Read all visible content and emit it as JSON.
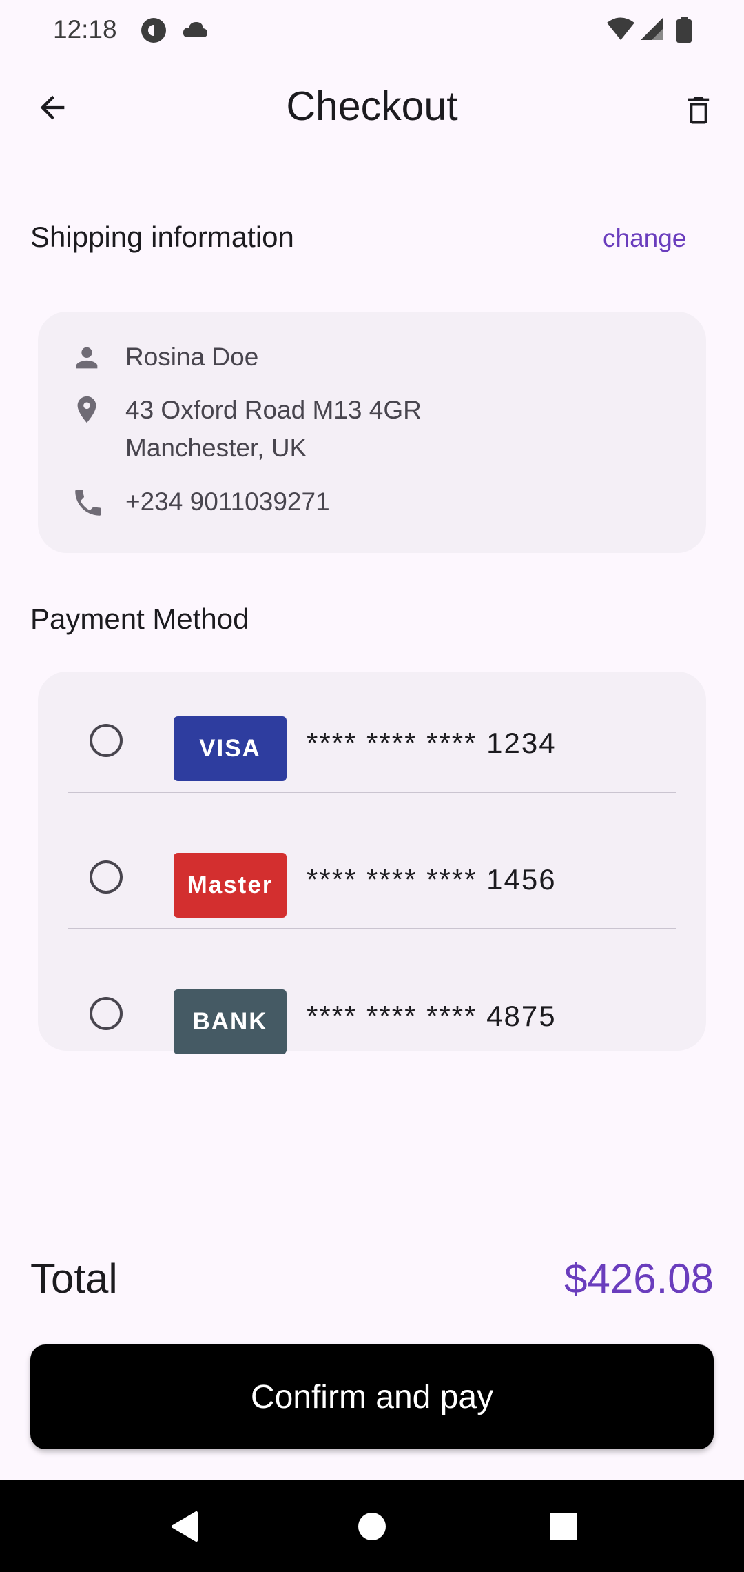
{
  "status_bar": {
    "time": "12:18",
    "icons": [
      "pocket-casts-icon",
      "cloud-icon",
      "wifi-icon",
      "signal-icon",
      "battery-icon"
    ]
  },
  "app_bar": {
    "title": "Checkout",
    "back_icon": "arrow-back-icon",
    "delete_icon": "trash-icon"
  },
  "shipping": {
    "title": "Shipping information",
    "change_label": "change",
    "name": "Rosina Doe",
    "address": "43 Oxford Road M13 4GR\nManchester, UK",
    "phone": "+234 9011039271"
  },
  "payment": {
    "title": "Payment Method",
    "methods": [
      {
        "badge": "VISA",
        "color": "#2e3d9f",
        "number": "**** **** **** 1234",
        "selected": false
      },
      {
        "badge": "Master",
        "color": "#d32f2f",
        "number": "**** **** **** 1456",
        "selected": false
      },
      {
        "badge": "BANK",
        "color": "#455a64",
        "number": "**** **** **** 4875",
        "selected": false
      }
    ]
  },
  "total": {
    "label": "Total",
    "value": "$426.08"
  },
  "confirm_button": {
    "label": "Confirm and pay"
  },
  "colors": {
    "accent": "#6a3dbd",
    "background": "#fdf7fe",
    "card": "#f4eff6"
  }
}
